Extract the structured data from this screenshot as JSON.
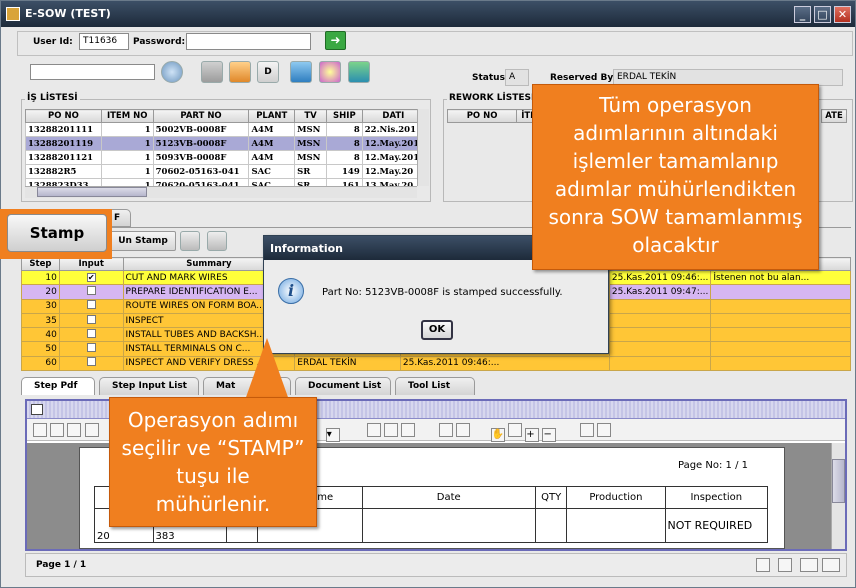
{
  "window": {
    "title": "E-SOW (TEST)"
  },
  "login": {
    "user_label": "User Id:",
    "user_value": "T11636",
    "password_label": "Password:",
    "password_value": ""
  },
  "status": {
    "status_label": "Status:",
    "status_value": "A",
    "reserved_label": "Reserved By:",
    "reserved_value": "ERDAL TEKİN"
  },
  "toolbar": {
    "d_label": "D"
  },
  "worklist": {
    "title": "İŞ LİSTESİ",
    "columns": [
      "PO NO",
      "ITEM NO",
      "PART NO",
      "PLANT",
      "TV",
      "SHIP",
      "DATI"
    ],
    "rows": [
      [
        "13288201111",
        "1",
        "5002VB-0008F",
        "A4M",
        "MSN",
        "8",
        "22.Nis.2011"
      ],
      [
        "13288201119",
        "1",
        "5123VB-0008F",
        "A4M",
        "MSN",
        "8",
        "12.May.201"
      ],
      [
        "13288201121",
        "1",
        "5093VB-0008F",
        "A4M",
        "MSN",
        "8",
        "12.May.201"
      ],
      [
        "132882R5",
        "1",
        "70602-05163-041",
        "SAC",
        "SR",
        "149",
        "12.May.20"
      ],
      [
        "1328823D33",
        "1",
        "70620-05163-041",
        "SAC",
        "SR",
        "161",
        "13.May.20"
      ]
    ]
  },
  "rework": {
    "title": "REWORK LİSTESİ",
    "columns": [
      "PO NO",
      "İTE",
      "ATE"
    ]
  },
  "stamp_toolbar": {
    "stamp_label": "Stamp",
    "unstamp_label": "Un Stamp",
    "tab_fragment": "F"
  },
  "steps": {
    "columns": [
      "Step",
      "Input",
      "Summary"
    ],
    "rows": [
      {
        "step": "10",
        "input": "✔",
        "summary": "CUT AND MARK WIRES",
        "by": "",
        "date": "",
        "date2": "25.Kas.2011 09:46:...",
        "note": "İstenen not bu alan..."
      },
      {
        "step": "20",
        "input": "",
        "summary": "PREPARE IDENTIFICATION E...",
        "by": "",
        "date": "",
        "date2": "25.Kas.2011 09:47:...",
        "note": ""
      },
      {
        "step": "30",
        "input": "",
        "summary": "ROUTE WIRES ON FORM BOA...",
        "by": "",
        "date": "",
        "date2": "",
        "note": ""
      },
      {
        "step": "35",
        "input": "",
        "summary": "INSPECT",
        "by": "",
        "date": "",
        "date2": "",
        "note": ""
      },
      {
        "step": "40",
        "input": "",
        "summary": "INSTALL TUBES AND BACKSH...",
        "by": "",
        "date": "",
        "date2": "",
        "note": ""
      },
      {
        "step": "50",
        "input": "",
        "summary": "INSTALL TERMINALS ON C...",
        "by": "",
        "date": "",
        "date2": "",
        "note": ""
      },
      {
        "step": "60",
        "input": "",
        "summary": "INSPECT AND VERIFY DRESS ...",
        "by": "ERDAL TEKİN",
        "date": "25.Kas.2011 09:46:...",
        "date2": "",
        "note": ""
      }
    ]
  },
  "dialog": {
    "title": "Information",
    "message": "Part No: 5123VB-0008F is stamped successfully.",
    "ok_label": "OK"
  },
  "bottom_tabs": [
    "Step Pdf",
    "Step Input List",
    "Mat",
    "Document List",
    "Tool List"
  ],
  "pdf": {
    "page_label": "Page No: 1   / 1",
    "columns": [
      "C",
      "",
      "",
      "Run Time",
      "Date",
      "QTY",
      "Production",
      "Inspection"
    ],
    "row_step": "20",
    "row_code": "383",
    "inspection_value": "NOT REQUIRED",
    "page_indicator": "Page 1 / 1"
  },
  "callouts": {
    "top": "Tüm operasyon adımlarının altındaki işlemler tamamlanıp adımlar mühürlendikten sonra SOW tamamlanmış olacaktır",
    "bottom": "Operasyon adımı seçilir ve “STAMP” tuşu ile mühürlenir."
  },
  "colors": {
    "callout": "#f07f1f",
    "stamped_row": "#ffff3a",
    "selected_row": "#d6b6f2",
    "pending_row": "#ffc636"
  },
  "icons": [
    "search-icon",
    "lock-icon",
    "refresh-icon",
    "palette-icon",
    "export-icon",
    "info-icon",
    "close-icon",
    "hand-icon",
    "zoom-in-icon",
    "zoom-out-icon"
  ]
}
